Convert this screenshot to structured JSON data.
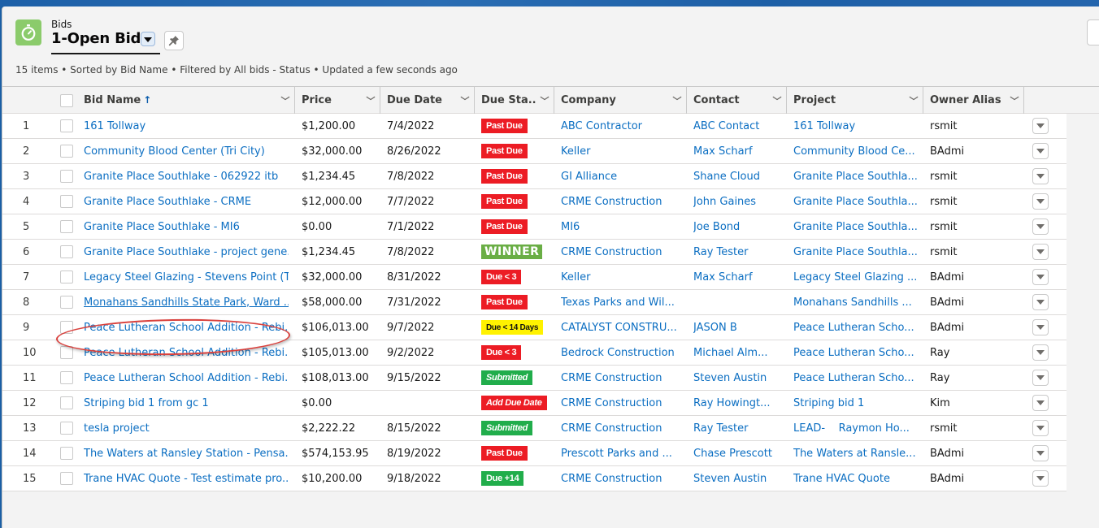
{
  "header": {
    "object_label": "Bids",
    "list_view_title": "1-Open Bids",
    "object_icon": "stopwatch-icon",
    "list_dropdown_icon": "chevron-down-icon",
    "pin_icon": "pin-icon",
    "meta": "15 items • Sorted by Bid Name • Filtered by All bids - Status • Updated a few seconds ago",
    "accent_color": "#8bcb6b"
  },
  "table": {
    "columns": [
      {
        "key": "bid_name",
        "label": "Bid Name",
        "sorted": "ascending",
        "sort_icon": "arrow-up-icon"
      },
      {
        "key": "price",
        "label": "Price"
      },
      {
        "key": "due_date",
        "label": "Due Date"
      },
      {
        "key": "due_status",
        "label": "Due Sta..."
      },
      {
        "key": "company",
        "label": "Company"
      },
      {
        "key": "contact",
        "label": "Contact"
      },
      {
        "key": "project",
        "label": "Project"
      },
      {
        "key": "owner_alias",
        "label": "Owner Alias"
      }
    ],
    "status_colors": {
      "red": "#ec1c24",
      "green": "#21ad4b",
      "yellow": "#fff200",
      "winner": "#6aae45"
    },
    "rows": [
      {
        "num": "1",
        "bid_name": "161 Tollway",
        "price": "$1,200.00",
        "due_date": "7/4/2022",
        "due_status": "Past Due",
        "status_style": "red",
        "company": "ABC Contractor",
        "contact": "ABC Contact",
        "project": "161 Tollway",
        "owner_alias": "rsmit"
      },
      {
        "num": "2",
        "bid_name": "Community Blood Center (Tri City)",
        "price": "$32,000.00",
        "due_date": "8/26/2022",
        "due_status": "Past Due",
        "status_style": "red",
        "company": "Keller",
        "contact": "Max Scharf",
        "project": "Community Blood Ce...",
        "owner_alias": "BAdmi"
      },
      {
        "num": "3",
        "bid_name": "Granite Place Southlake - 062922 itb",
        "price": "$1,234.45",
        "due_date": "7/8/2022",
        "due_status": "Past Due",
        "status_style": "red",
        "company": "GI Alliance",
        "contact": "Shane Cloud",
        "project": "Granite Place Southla...",
        "owner_alias": "rsmit"
      },
      {
        "num": "4",
        "bid_name": "Granite Place Southlake - CRME",
        "price": "$12,000.00",
        "due_date": "7/7/2022",
        "due_status": "Past Due",
        "status_style": "red",
        "company": "CRME Construction",
        "contact": "John Gaines",
        "project": "Granite Place Southla...",
        "owner_alias": "rsmit"
      },
      {
        "num": "5",
        "bid_name": "Granite Place Southlake - MI6",
        "price": "$0.00",
        "due_date": "7/1/2022",
        "due_status": "Past Due",
        "status_style": "red",
        "company": "MI6",
        "contact": "Joe Bond",
        "project": "Granite Place Southla...",
        "owner_alias": "rsmit"
      },
      {
        "num": "6",
        "bid_name": "Granite Place Southlake - project gene...",
        "price": "$1,234.45",
        "due_date": "7/8/2022",
        "due_status": "WINNER",
        "status_style": "winner",
        "company": "CRME Construction",
        "contact": "Ray Tester",
        "project": "Granite Place Southla...",
        "owner_alias": "rsmit"
      },
      {
        "num": "7",
        "bid_name": "Legacy Steel Glazing - Stevens Point (T...",
        "price": "$32,000.00",
        "due_date": "8/31/2022",
        "due_status": "Due < 3",
        "status_style": "red",
        "company": "Keller",
        "contact": "Max Scharf",
        "project": "Legacy Steel Glazing ...",
        "owner_alias": "BAdmi"
      },
      {
        "num": "8",
        "bid_name": "Monahans Sandhills State Park, Ward ...",
        "price": "$58,000.00",
        "due_date": "7/31/2022",
        "due_status": "Past Due",
        "status_style": "red",
        "company": "Texas Parks and Wil...",
        "contact": "",
        "project": "Monahans Sandhills ...",
        "owner_alias": "BAdmi",
        "hover": true
      },
      {
        "num": "9",
        "bid_name": "Peace Lutheran School Addition - Rebi...",
        "price": "$106,013.00",
        "due_date": "9/7/2022",
        "due_status": "Due < 14 Days",
        "status_style": "yellow",
        "company": "CATALYST CONSTRU...",
        "contact": "JASON B",
        "project": "Peace Lutheran Scho...",
        "owner_alias": "BAdmi",
        "annotated": true
      },
      {
        "num": "10",
        "bid_name": "Peace Lutheran School Addition - Rebi...",
        "price": "$105,013.00",
        "due_date": "9/2/2022",
        "due_status": "Due < 3",
        "status_style": "red",
        "company": "Bedrock Construction",
        "contact": "Michael Alm...",
        "project": "Peace Lutheran Scho...",
        "owner_alias": "Ray"
      },
      {
        "num": "11",
        "bid_name": "Peace Lutheran School Addition - Rebi...",
        "price": "$108,013.00",
        "due_date": "9/15/2022",
        "due_status": "Submitted",
        "status_style": "green-italic",
        "company": "CRME Construction",
        "contact": "Steven Austin",
        "project": "Peace Lutheran Scho...",
        "owner_alias": "Ray"
      },
      {
        "num": "12",
        "bid_name": "Striping bid 1 from gc 1",
        "price": "$0.00",
        "due_date": "",
        "due_status": "Add Due Date",
        "status_style": "red-italic",
        "company": "CRME Construction",
        "contact": "Ray Howingt...",
        "project": "Striping bid 1",
        "owner_alias": "Kim"
      },
      {
        "num": "13",
        "bid_name": "tesla project",
        "price": "$2,222.22",
        "due_date": "8/15/2022",
        "due_status": "Submitted",
        "status_style": "green-italic",
        "company": "CRME Construction",
        "contact": "Ray Tester",
        "project": "LEAD-    Raymon Ho...",
        "owner_alias": "rsmit"
      },
      {
        "num": "14",
        "bid_name": "The Waters at Ransley Station - Pensa...",
        "price": "$574,153.95",
        "due_date": "8/19/2022",
        "due_status": "Past Due",
        "status_style": "red",
        "company": "Prescott Parks and ...",
        "contact": "Chase Prescott",
        "project": "The Waters at Ransle...",
        "owner_alias": "BAdmi"
      },
      {
        "num": "15",
        "bid_name": "Trane HVAC Quote - Test estimate pro...",
        "price": "$10,200.00",
        "due_date": "9/18/2022",
        "due_status": "Due +14",
        "status_style": "green",
        "company": "CRME Construction",
        "contact": "Steven Austin",
        "project": "Trane HVAC Quote",
        "owner_alias": "BAdmi"
      }
    ]
  }
}
